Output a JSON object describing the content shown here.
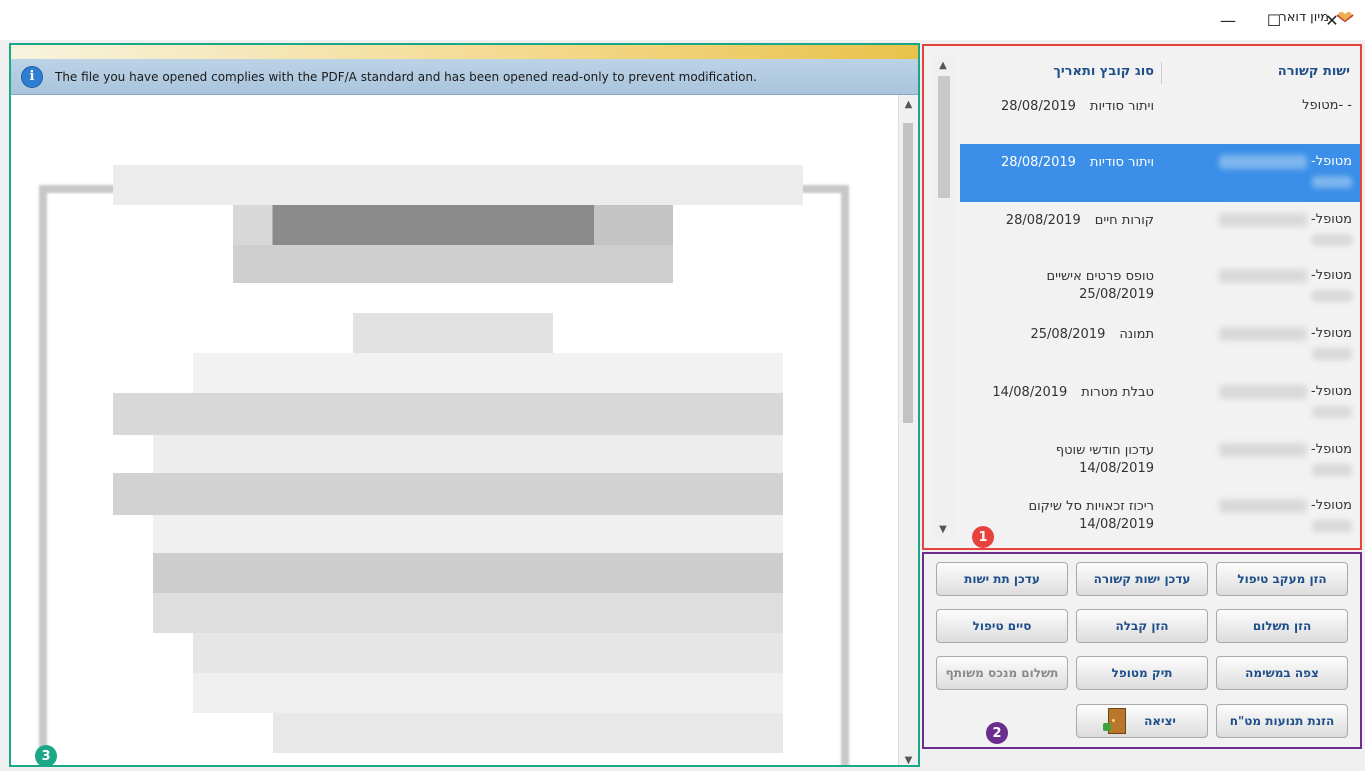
{
  "window": {
    "title": "מיון דואר",
    "minimize": "—",
    "maximize": "☐",
    "close": "✕"
  },
  "info_bar": {
    "icon": "i",
    "message": "The file you have opened complies with the PDF/A standard and has been opened read-only to prevent modification."
  },
  "list": {
    "headers": {
      "related_entity": "ישות קשורה",
      "file_type_date": "סוג קובץ ותאריך"
    },
    "rows": [
      {
        "entity": "- -מטופל",
        "type": "ויתור סודיות",
        "date": "28/08/2019",
        "selected": false
      },
      {
        "entity": "מטופל-",
        "type": "ויתור סודיות",
        "date": "28/08/2019",
        "selected": true
      },
      {
        "entity": "מטופל-",
        "type": "קורות חיים",
        "date": "28/08/2019",
        "selected": false
      },
      {
        "entity": "מטופל-",
        "type": "טופס פרטים אישיים",
        "date": "25/08/2019",
        "selected": false
      },
      {
        "entity": "מטופל-",
        "type": "תמונה",
        "date": "25/08/2019",
        "selected": false
      },
      {
        "entity": "מטופל-",
        "type": "טבלת מטרות",
        "date": "14/08/2019",
        "selected": false
      },
      {
        "entity": "מטופל-",
        "type": "עדכון חודשי שוטף",
        "date": "14/08/2019",
        "selected": false
      },
      {
        "entity": "מטופל-",
        "type": "ריכוז זכאויות סל שיקום",
        "date": "14/08/2019",
        "selected": false
      }
    ]
  },
  "buttons": {
    "enter_tracking": "הזן מעקב טיפול",
    "update_related_entity": "עדכן ישות קשורה",
    "update_sub_entity": "עדכן תת ישות",
    "enter_payment": "הזן תשלום",
    "enter_receipt": "הזן קבלה",
    "end_treatment": "סיים טיפול",
    "view_task": "צפה במשימה",
    "patient_file": "תיק מטופל",
    "shared_asset_payment": "תשלום מנכס משותף",
    "enter_fx_transactions": "הזנת תנועות מט\"ח",
    "exit": "יציאה"
  },
  "badges": {
    "one": "1",
    "two": "2",
    "three": "3"
  },
  "colors": {
    "list_frame": "#e8423f",
    "buttons_frame": "#6b2e8e",
    "viewer_frame": "#1aa889",
    "selected_row": "#3b8fe8",
    "header_text": "#1f4f8a"
  },
  "icons": {
    "app": "envelope-heart-icon",
    "info": "info-icon",
    "exit": "door-exit-icon"
  }
}
